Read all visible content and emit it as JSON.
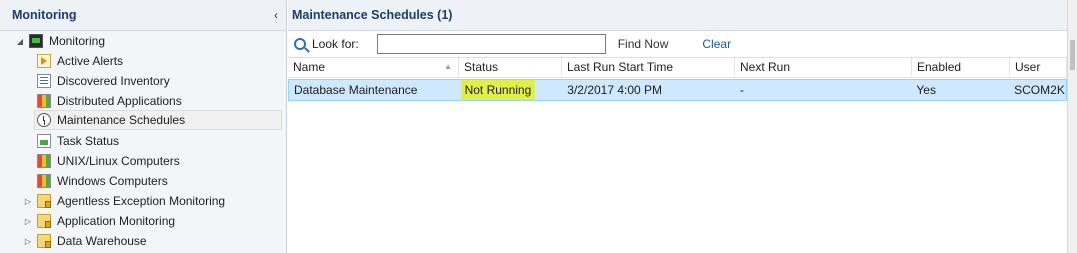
{
  "nav": {
    "title": "Monitoring",
    "collapse_glyph": "‹",
    "items": [
      {
        "label": "Monitoring",
        "icon": "monitor-icon",
        "expander": "◢",
        "level": 0
      },
      {
        "label": "Active Alerts",
        "icon": "alert-icon",
        "level": 1
      },
      {
        "label": "Discovered Inventory",
        "icon": "list-icon",
        "level": 1
      },
      {
        "label": "Distributed Applications",
        "icon": "grid-icon",
        "level": 1
      },
      {
        "label": "Maintenance Schedules",
        "icon": "clock-icon",
        "level": 1,
        "selected": true
      },
      {
        "label": "Task Status",
        "icon": "task-icon",
        "level": 1
      },
      {
        "label": "UNIX/Linux Computers",
        "icon": "grid-icon",
        "level": 1
      },
      {
        "label": "Windows Computers",
        "icon": "grid-icon",
        "level": 1
      },
      {
        "label": "Agentless Exception Monitoring",
        "icon": "folder-icon",
        "expander": "▷",
        "level": 1
      },
      {
        "label": "Application Monitoring",
        "icon": "folder-icon",
        "expander": "▷",
        "level": 1
      },
      {
        "label": "Data Warehouse",
        "icon": "folder-icon",
        "expander": "▷",
        "level": 1
      }
    ]
  },
  "main": {
    "title": "Maintenance Schedules (1)",
    "search": {
      "look_for_label": "Look for:",
      "value": "",
      "placeholder": "",
      "find_now": "Find Now",
      "clear": "Clear"
    },
    "columns": [
      "Name",
      "Status",
      "Last Run Start Time",
      "Next Run",
      "Enabled",
      "User"
    ],
    "rows": [
      [
        "Database Maintenance",
        "Not Running",
        "3/2/2017 4:00 PM",
        "-",
        "Yes",
        "SCOM2K"
      ]
    ]
  },
  "colors": {
    "selected_row": "#cde8ff",
    "status_highlight": "#dff04a",
    "header_text": "#1d3c6e",
    "link": "#1f5aa6"
  }
}
